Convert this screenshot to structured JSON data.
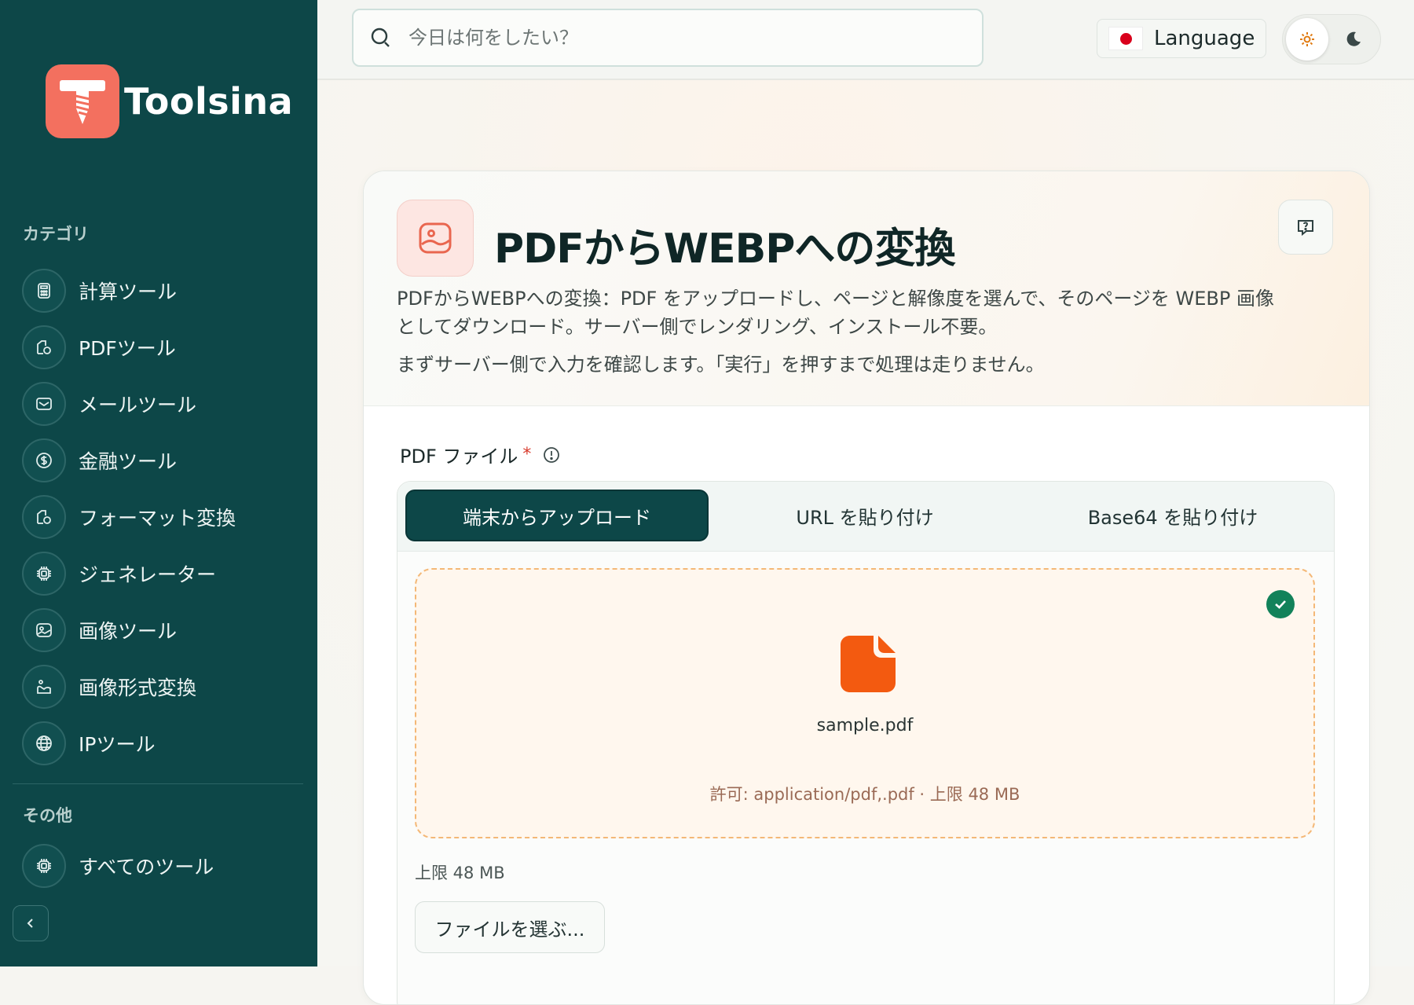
{
  "brand": {
    "name": "Toolsina"
  },
  "sidebar": {
    "categories_label": "カテゴリ",
    "items": [
      {
        "label": "計算ツール",
        "icon": "calculator-icon"
      },
      {
        "label": "PDFツール",
        "icon": "pdf-shapes-icon"
      },
      {
        "label": "メールツール",
        "icon": "mail-icon"
      },
      {
        "label": "金融ツール",
        "icon": "dollar-icon"
      },
      {
        "label": "フォーマット変換",
        "icon": "shapes-icon"
      },
      {
        "label": "ジェネレーター",
        "icon": "chip-icon"
      },
      {
        "label": "画像ツール",
        "icon": "image-icon"
      },
      {
        "label": "画像形式変換",
        "icon": "image-convert-icon"
      },
      {
        "label": "IPツール",
        "icon": "globe-icon"
      }
    ],
    "other_label": "その他",
    "other_items": [
      {
        "label": "すべてのツール",
        "icon": "chip-icon"
      }
    ]
  },
  "topbar": {
    "search_placeholder": "今日は何をしたい？",
    "language_label": "Language"
  },
  "tool": {
    "title": "PDFからWEBPへの変換",
    "description": "PDFからWEBPへの変換：PDF をアップロードし、ページと解像度を選んで、そのページを WEBP 画像としてダウンロード。サーバー側でレンダリング、インストール不要。",
    "note": "まずサーバー側で入力を確認します。「実行」を押すまで処理は走りません。"
  },
  "form": {
    "pdf_label": "PDF ファイル",
    "required_mark": "*",
    "tabs": [
      "端末からアップロード",
      "URL を貼り付け",
      "Base64 を貼り付け"
    ],
    "file_name": "sample.pdf",
    "allowed": "許可: application/pdf,.pdf · 上限 48 MB",
    "limit": "上限 48 MB",
    "choose_button": "ファイルを選ぶ..."
  },
  "colors": {
    "sidebar_bg": "#0d4748",
    "accent_orange": "#f35a10",
    "logo_coral": "#f3705f",
    "success_green": "#12825a"
  }
}
